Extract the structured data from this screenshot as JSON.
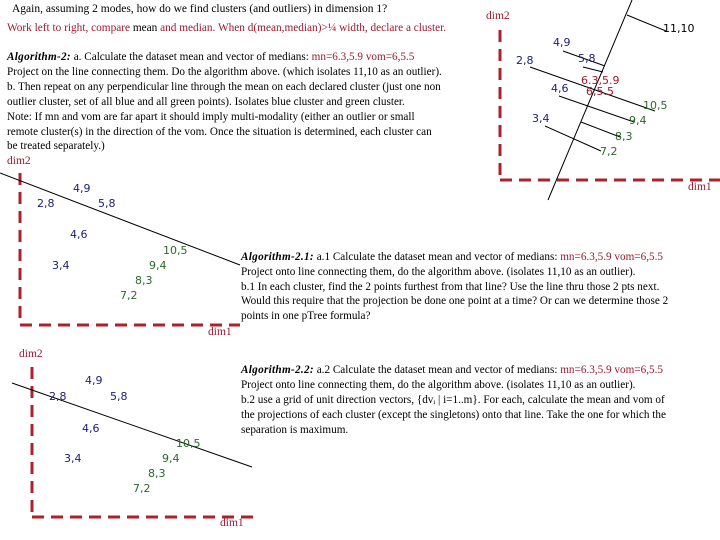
{
  "header": {
    "title": "Again, assuming 2 modes, how do we find clusters (and outliers) in dimension 1?",
    "subtitle_parts": [
      {
        "text": "Work left to right, compare ",
        "color": "red"
      },
      {
        "text": "mean ",
        "color": "black"
      },
      {
        "text": "and median.  When d(mean,median)>¼ width, declare a cluster.",
        "color": "red"
      }
    ]
  },
  "algorithm2": {
    "name": "Algorithm-2:",
    "line1_black": " a.  Calculate the dataset mean and vector of medians:  ",
    "line1_red": "mn=6.3,5.9  vom=6,5.5",
    "lines": [
      "Project on the line connecting them.  Do the algorithm above. (which isolates 11,10 as an outlier).",
      "b.  Then repeat on any perpendicular line through the mean on each declared cluster (just one non",
      "outlier cluster, set of all blue and all green points). Isolates blue cluster and green cluster.",
      "Note:  If mn and vom are far apart it should imply multi-modality (either an outlier or small",
      "remote cluster(s) in the direction of the vom. Once the situation is determined, each cluster  can",
      "be treated separately.)"
    ]
  },
  "algorithm21": {
    "name": "Algorithm-2.1:",
    "line1_black": " a.1 Calculate the dataset mean and vector of medians:  ",
    "line1_red": "mn=6.3,5.9  vom=6,5.5",
    "lines": [
      "Project onto line connecting them, do the algorithm above. (isolates 11,10 as an outlier).",
      "b.1  In each cluster, find the 2 points furthest from that line?  Use the line thru those 2 pts next.",
      "Would this require that the projection be done one point at a time?  Or can we determine those 2",
      "points in one pTree formula?"
    ]
  },
  "algorithm22": {
    "name": "Algorithm-2.2:",
    "line1_black": " a.2   Calculate the dataset mean and vector of medians:  ",
    "line1_red": "mn=6.3,5.9  vom=6,5.5",
    "lines": [
      "Project onto line connecting them, do the algorithm above. (isolates 11,10 as an outlier).",
      "b.2 use a grid of unit direction vectors, {dvᵢ | i=1..m}.  For each, calculate the mean and vom of",
      "the projections of each cluster (except the singletons) onto that line.  Take the one for which the",
      "separation is maximum."
    ]
  },
  "axes": {
    "x_label": "dim1",
    "y_label": "dim2"
  },
  "colors": {
    "red": "#9b1b30",
    "blue": "#1c1c78",
    "green": "#2a6a2a",
    "axis": "#b0202a"
  },
  "diagram_top_right": {
    "outlier": "11,10",
    "blue_points": [
      "4,9",
      "5,8",
      "2,8",
      "4,6",
      "3,4"
    ],
    "green_points": [
      "10,5",
      "9,4",
      "8,3",
      "7,2"
    ],
    "mean_label": "6.3,5.9",
    "vom_label": "6,5.5"
  },
  "diagram_mid_left": {
    "blue_points": [
      "4,9",
      "2,8",
      "5,8",
      "4,6",
      "3,4"
    ],
    "green_points": [
      "10,5",
      "9,4",
      "8,3",
      "7,2"
    ]
  },
  "diagram_bottom_left": {
    "blue_points": [
      "4,9",
      "2,8",
      "5,8",
      "4,6",
      "3,4"
    ],
    "green_points": [
      "10,5",
      "9,4",
      "8,3",
      "7,2"
    ]
  }
}
